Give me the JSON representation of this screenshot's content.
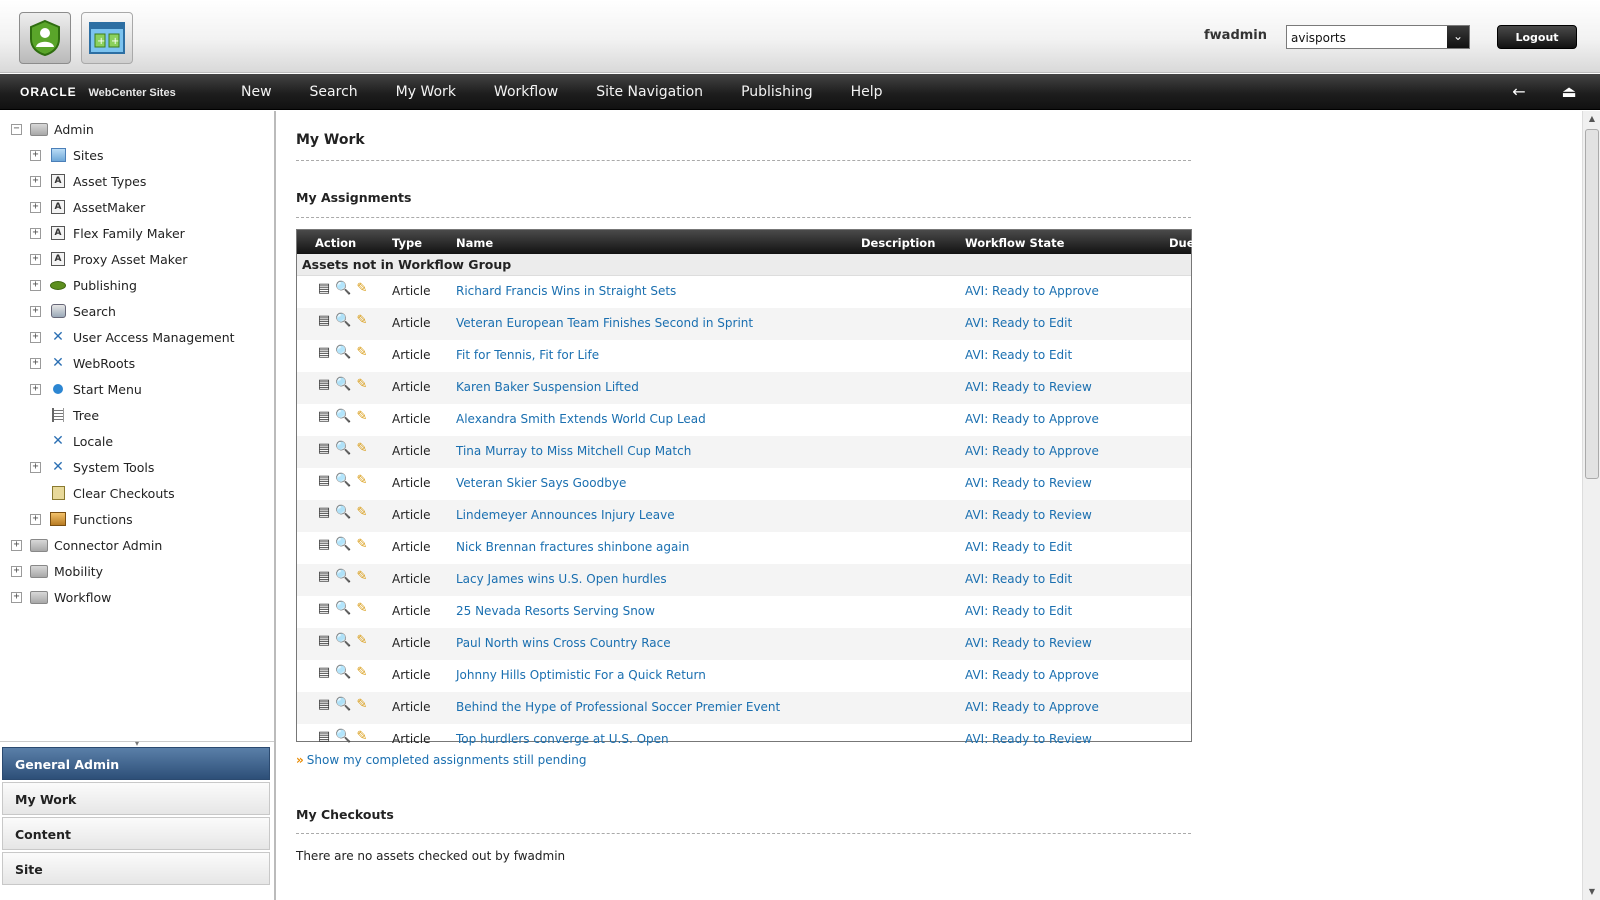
{
  "header": {
    "username": "fwadmin",
    "site_selected": "avisports",
    "logout_label": "Logout"
  },
  "navbar": {
    "brand_oracle": "ORACLE",
    "brand_product": "WebCenter Sites",
    "items": [
      "New",
      "Search",
      "My Work",
      "Workflow",
      "Site Navigation",
      "Publishing",
      "Help"
    ]
  },
  "tree": {
    "root": "Admin",
    "children": [
      "Sites",
      "Asset Types",
      "AssetMaker",
      "Flex Family Maker",
      "Proxy Asset Maker",
      "Publishing",
      "Search",
      "User Access Management",
      "WebRoots",
      "Start Menu",
      "Tree",
      "Locale",
      "System Tools",
      "Clear Checkouts",
      "Functions"
    ],
    "top_level": [
      "Connector Admin",
      "Mobility",
      "Workflow"
    ]
  },
  "accordion": [
    "General Admin",
    "My Work",
    "Content",
    "Site"
  ],
  "main": {
    "title": "My Work",
    "assignments_title": "My Assignments",
    "columns": {
      "action": "Action",
      "type": "Type",
      "name": "Name",
      "description": "Description",
      "workflow_state": "Workflow State",
      "due": "Due"
    },
    "group_label": "Assets not in Workflow Group",
    "rows": [
      {
        "type": "Article",
        "name": "Richard Francis Wins in Straight Sets",
        "state": "AVI: Ready to Approve"
      },
      {
        "type": "Article",
        "name": "Veteran European Team Finishes Second in Sprint",
        "state": "AVI: Ready to Edit"
      },
      {
        "type": "Article",
        "name": "Fit for Tennis, Fit for Life",
        "state": "AVI: Ready to Edit"
      },
      {
        "type": "Article",
        "name": "Karen Baker Suspension Lifted",
        "state": "AVI: Ready to Review"
      },
      {
        "type": "Article",
        "name": "Alexandra Smith Extends World Cup Lead",
        "state": "AVI: Ready to Approve"
      },
      {
        "type": "Article",
        "name": "Tina Murray to Miss Mitchell Cup Match",
        "state": "AVI: Ready to Approve"
      },
      {
        "type": "Article",
        "name": "Veteran Skier Says Goodbye",
        "state": "AVI: Ready to Review"
      },
      {
        "type": "Article",
        "name": "Lindemeyer Announces Injury Leave",
        "state": "AVI: Ready to Review"
      },
      {
        "type": "Article",
        "name": "Nick Brennan fractures shinbone again",
        "state": "AVI: Ready to Edit"
      },
      {
        "type": "Article",
        "name": "Lacy James wins U.S. Open hurdles",
        "state": "AVI: Ready to Edit"
      },
      {
        "type": "Article",
        "name": "25 Nevada Resorts Serving Snow",
        "state": "AVI: Ready to Edit"
      },
      {
        "type": "Article",
        "name": "Paul North wins Cross Country Race",
        "state": "AVI: Ready to Review"
      },
      {
        "type": "Article",
        "name": "Johnny Hills Optimistic For a Quick Return",
        "state": "AVI: Ready to Approve"
      },
      {
        "type": "Article",
        "name": "Behind the Hype of Professional Soccer Premier Event",
        "state": "AVI: Ready to Approve"
      },
      {
        "type": "Article",
        "name": "Top hurdlers converge at U.S. Open",
        "state": "AVI: Ready to Review"
      }
    ],
    "show_completed": "Show my completed assignments still pending",
    "checkouts_title": "My Checkouts",
    "checkouts_empty": "There are no assets checked out by fwadmin"
  },
  "colors": {
    "link": "#1a6fb0",
    "accordion_active": "#2d4f78",
    "navbar": "#1e1e1e"
  }
}
